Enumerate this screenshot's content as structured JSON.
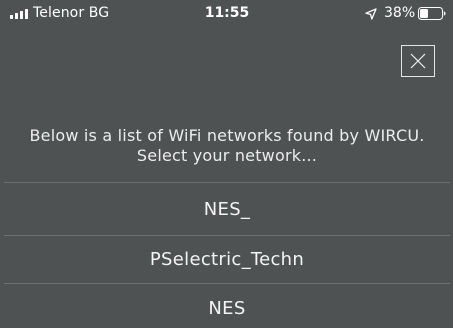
{
  "status_bar": {
    "carrier": "Telenor BG",
    "time": "11:55",
    "battery_percent": "38%",
    "battery_level": 0.38,
    "signal_bars": 4,
    "icons": [
      "signal-icon",
      "location-arrow-icon",
      "battery-icon"
    ]
  },
  "close_button": {
    "icon": "close-icon"
  },
  "instructions": {
    "text": "Below is a list of WiFi networks found by WIRCU. Select your network..."
  },
  "networks": [
    {
      "name": "NES_"
    },
    {
      "name": "PSelectric_Techn"
    },
    {
      "name": "NES"
    }
  ],
  "colors": {
    "background": "#4f5253",
    "divider": "#6d7071",
    "text": "#f4f4f4"
  }
}
